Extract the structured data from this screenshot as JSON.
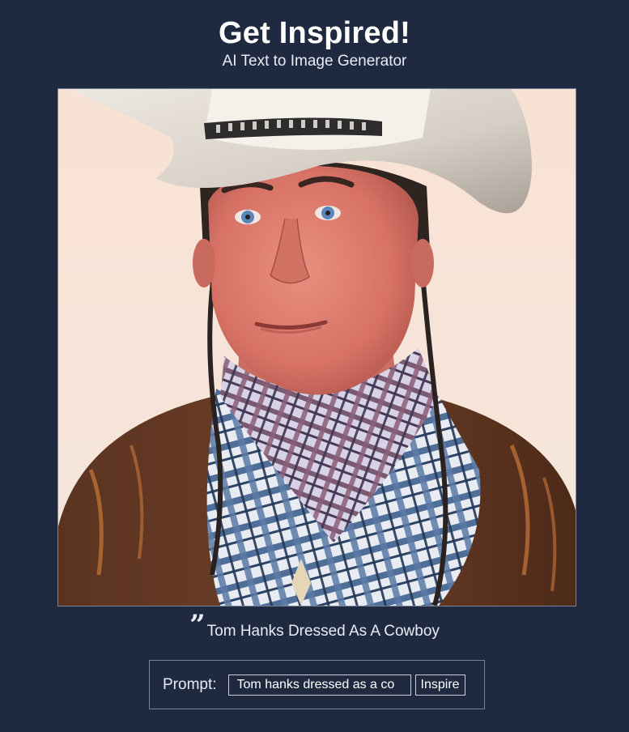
{
  "header": {
    "title": "Get Inspired!",
    "subtitle": "AI Text to Image Generator"
  },
  "generated_image": {
    "description_icon": "generated-portrait-image"
  },
  "caption": {
    "quote_glyph": "”",
    "text": "Tom Hanks Dressed As A Cowboy"
  },
  "prompt": {
    "label": "Prompt:",
    "value": "Tom hanks dressed as a co",
    "button_label": "Inspire"
  },
  "colors": {
    "background": "#1f2a40",
    "text": "#ffffff",
    "border": "#7a8296"
  }
}
